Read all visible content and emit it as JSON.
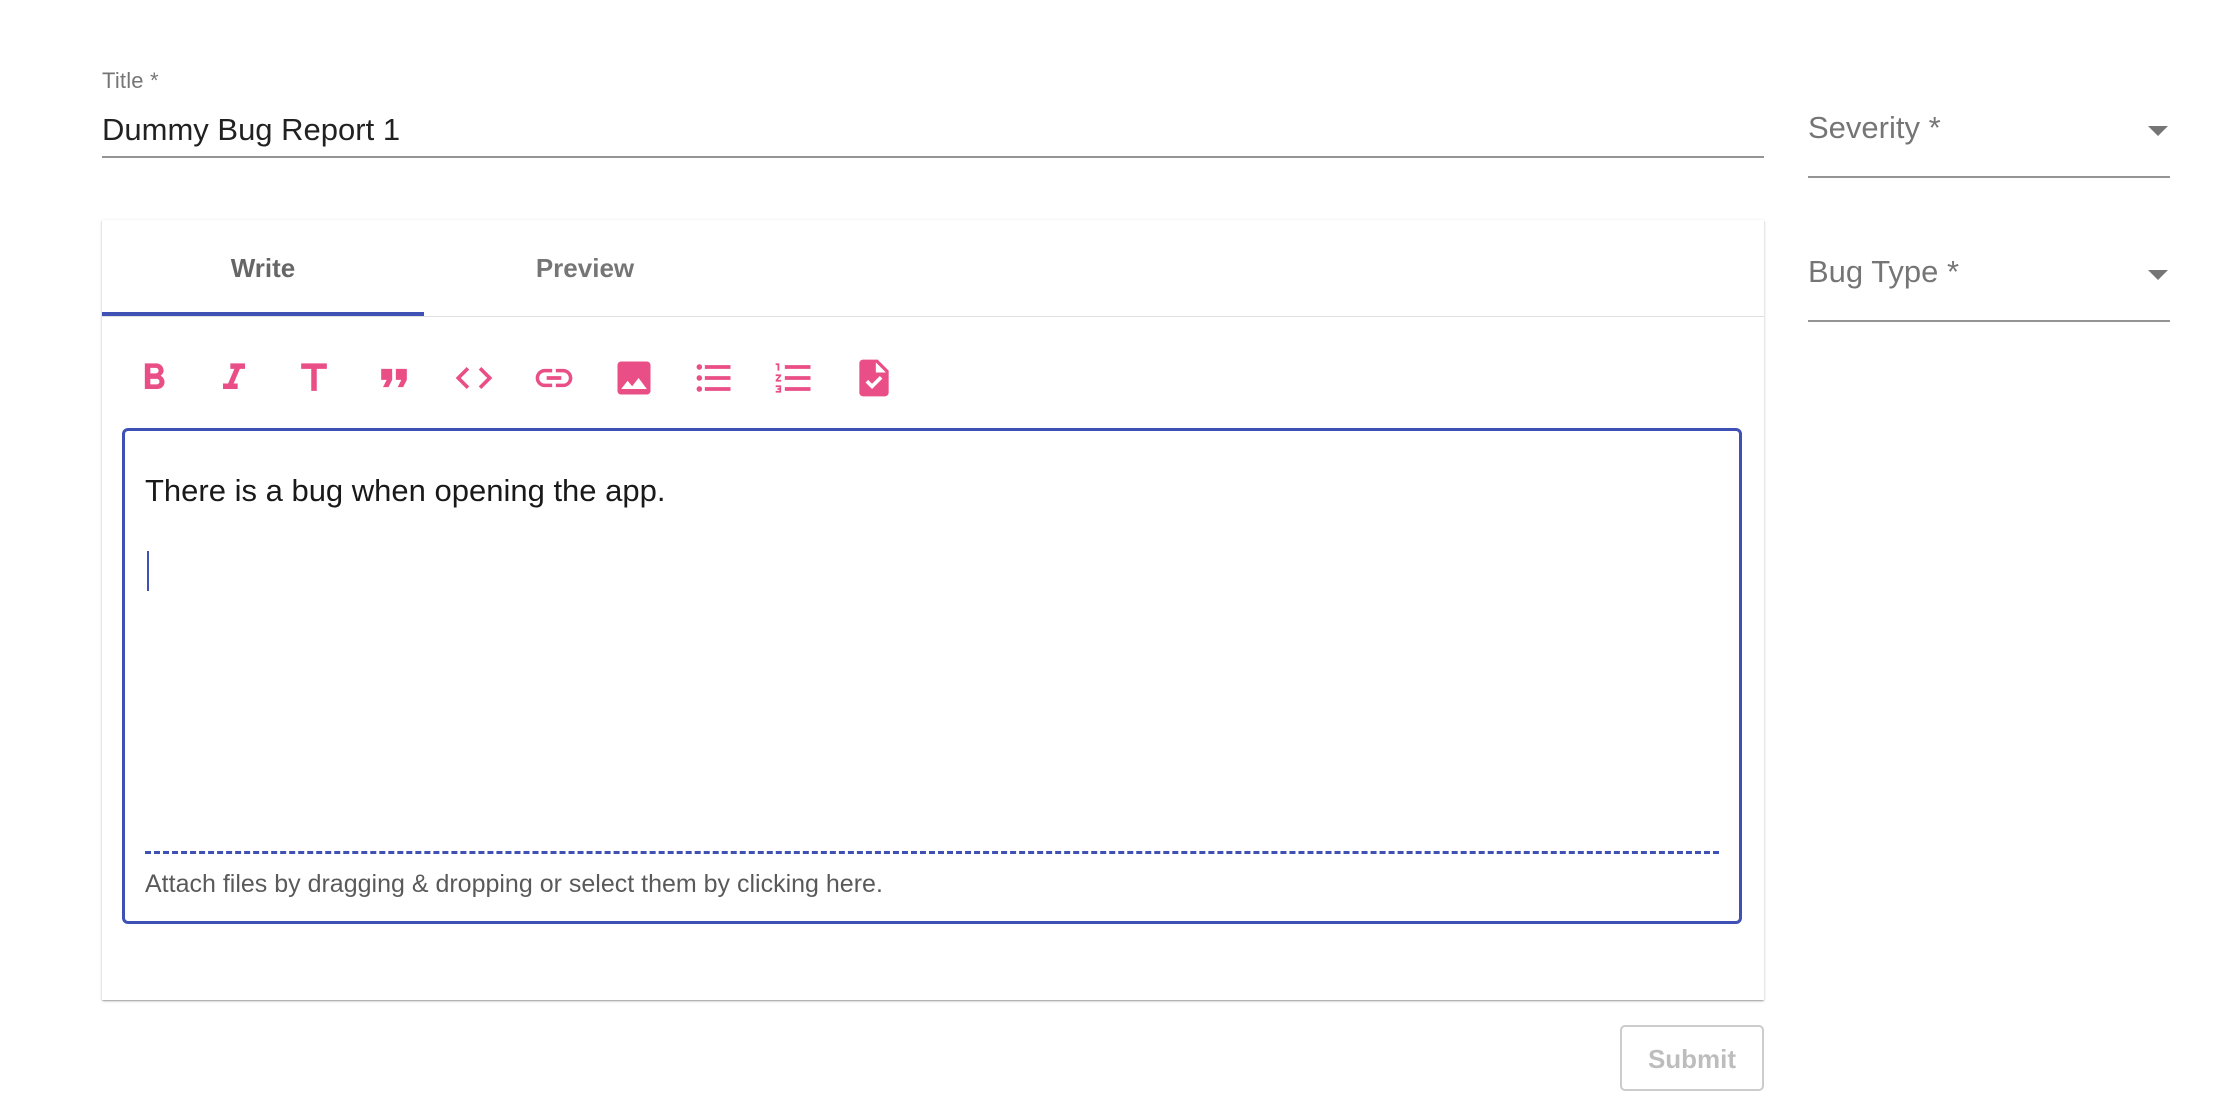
{
  "form": {
    "title_label": "Title *",
    "title_value": "Dummy Bug Report 1",
    "severity_label": "Severity *",
    "bug_type_label": "Bug Type *",
    "submit_label": "Submit"
  },
  "editor": {
    "tabs": [
      {
        "label": "Write",
        "active": true
      },
      {
        "label": "Preview",
        "active": false
      }
    ],
    "toolbar": [
      {
        "icon": "bold-icon"
      },
      {
        "icon": "italic-icon"
      },
      {
        "icon": "header-icon"
      },
      {
        "icon": "quote-icon"
      },
      {
        "icon": "code-icon"
      },
      {
        "icon": "link-icon"
      },
      {
        "icon": "image-icon"
      },
      {
        "icon": "unordered-list-icon"
      },
      {
        "icon": "ordered-list-icon"
      },
      {
        "icon": "checked-document-icon"
      }
    ],
    "content": "There is a bug when opening the app.",
    "attach_hint": "Attach files by dragging & dropping or select them by clicking here."
  },
  "colors": {
    "accent": "#3f51b5",
    "toolbar_icon": "#e94f86"
  }
}
